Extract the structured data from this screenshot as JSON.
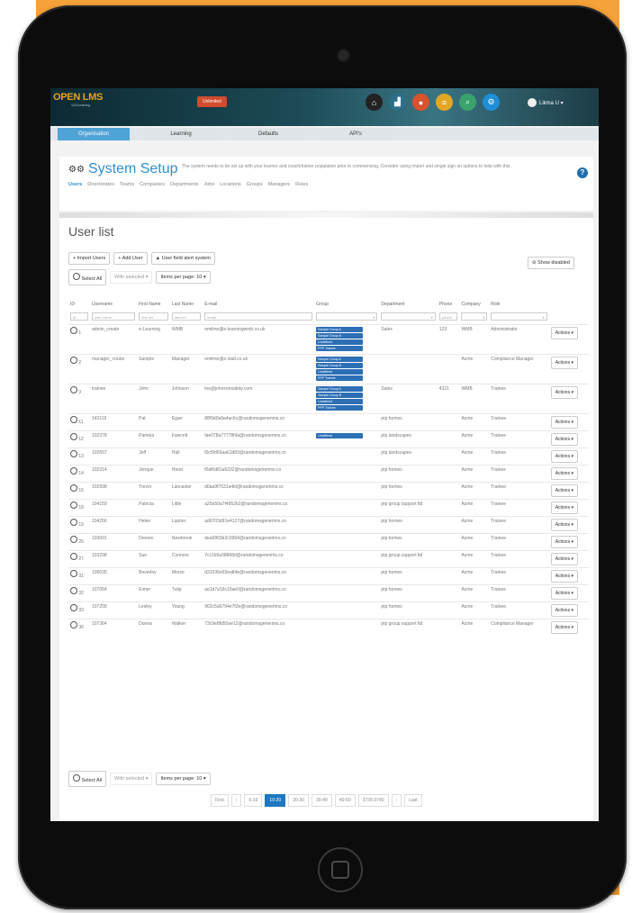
{
  "app": {
    "logo": "OPEN LMS",
    "logo_sub": "VLE/Learning",
    "badge": "Unlimited",
    "user_label": "Likma U ▾"
  },
  "nav_tabs": [
    "Organisation",
    "Learning",
    "Defaults",
    "API's"
  ],
  "header": {
    "title": "System Setup",
    "description": "The system needs to be set up with your learner and coach/trainer population prior to commencing. Consider using import and single sign on options to help with this.",
    "help": "?"
  },
  "subtabs": [
    "Users",
    "Directorates",
    "Teams",
    "Companies",
    "Departments",
    "Jobs",
    "Locations",
    "Groups",
    "Managers",
    "Roles"
  ],
  "page_title": "User list",
  "toolbar": {
    "import": "Import Users",
    "add": "Add User",
    "alert": "User field alert system",
    "show_disabled": "Show disabled"
  },
  "select_row": {
    "select_all": "Select All",
    "with_selected": "With selected ▾",
    "per_page": "Items per page: 10 ▾"
  },
  "columns": [
    "ID",
    "Username",
    "First Name",
    "Last Name",
    "E-mail",
    "Group",
    "Department",
    "Phone",
    "Company",
    "Role"
  ],
  "filters": {
    "id": "id",
    "username": "user name",
    "first": "first nm",
    "last": "last nm",
    "email": "email",
    "phone": "phone"
  },
  "rows": [
    {
      "id": "1",
      "username": "admin_create",
      "first": "e-Learning",
      "last": "WMB",
      "email": "emilme@e-learningwmb.co.uk",
      "groups": [
        "Sample Group A",
        "Sample Group B",
        "Undefined",
        "PPP Trainee"
      ],
      "dept": "Sales",
      "phone": "123",
      "company": "WMB",
      "role": "Administrator"
    },
    {
      "id": "2",
      "username": "manager_create",
      "first": "Sample",
      "last": "Manager",
      "email": "emilme@e-stall.co.uk",
      "groups": [
        "Sample Group A",
        "Sample Group B",
        "Undefined",
        "PPP Trainee"
      ],
      "dept": "",
      "phone": "",
      "company": "Acme",
      "role": "Compliance Manager"
    },
    {
      "id": "3",
      "username": "trainee",
      "first": "John",
      "last": "Johnson",
      "email": "lee@johnsonsafety.com",
      "groups": [
        "Sample Group A",
        "Sample Group B",
        "Undefined",
        "PPP Trainee"
      ],
      "dept": "Sales",
      "phone": "4321",
      "company": "WMB",
      "role": "Trainee"
    },
    {
      "id": "11",
      "username": "143119",
      "first": "Pat",
      "last": "Egan",
      "email": "88f3d0a9a4ac6c@randomsgenerims.co",
      "groups": [],
      "dept": "ptp homes",
      "phone": "",
      "company": "Acme",
      "role": "Trainee"
    },
    {
      "id": "12",
      "username": "102378",
      "first": "Pamela",
      "last": "Fawcett",
      "email": "fae078a77778f4a@randomsgenerims.co",
      "groups": [
        "Undefined"
      ],
      "dept": "ptp landscapes",
      "phone": "",
      "company": "Acme",
      "role": "Trainee"
    },
    {
      "id": "13",
      "username": "102657",
      "first": "Jeff",
      "last": "Hall",
      "email": "f0cf9d65aa61d83@randomsgenerims.co",
      "groups": [],
      "dept": "ptp landscapes",
      "phone": "",
      "company": "Acme",
      "role": "Trainee"
    },
    {
      "id": "14",
      "username": "102314",
      "first": "Jonque",
      "last": "Hood",
      "email": "f0af0d81a6332@randomsgenerims.co",
      "groups": [],
      "dept": "ptp homes",
      "phone": "",
      "company": "Acme",
      "role": "Trainee"
    },
    {
      "id": "16",
      "username": "102998",
      "first": "Trevor",
      "last": "Lancaster",
      "email": "d0aa9f7631a4ld@randomsgenerims.co",
      "groups": [],
      "dept": "ptp homes",
      "phone": "",
      "company": "Acme",
      "role": "Trainee"
    },
    {
      "id": "18",
      "username": "104159",
      "first": "Patricia",
      "last": "Little",
      "email": "a29a50a7f4952b2@randomsgenerims.co",
      "groups": [],
      "dept": "ptp group support ltd",
      "phone": "",
      "company": "Acme",
      "role": "Trainee"
    },
    {
      "id": "19",
      "username": "104256",
      "first": "Helen",
      "last": "Lupton",
      "email": "ad0703d91e4127@randomsgenerims.co",
      "groups": [],
      "dept": "ptp homes",
      "phone": "",
      "company": "Acme",
      "role": "Trainee"
    },
    {
      "id": "26",
      "username": "103091",
      "first": "Doreen",
      "last": "Newbrook",
      "email": "dea6803b2c0994@randomsgenerims.co",
      "groups": [],
      "dept": "ptp homes",
      "phone": "",
      "company": "Acme",
      "role": "Trainee"
    },
    {
      "id": "27",
      "username": "103298",
      "first": "Sue",
      "last": "Connors",
      "email": "7cc1b9a38868d@randomsgenerims.co",
      "groups": [],
      "dept": "ptp group support ltd",
      "phone": "",
      "company": "Acme",
      "role": "Trainee"
    },
    {
      "id": "31",
      "username": "106035",
      "first": "Beverley",
      "last": "Morse",
      "email": "d31036e65ea84e@randomsgenerims.co",
      "groups": [],
      "dept": "ptp homes",
      "phone": "",
      "company": "Acme",
      "role": "Trainee"
    },
    {
      "id": "32",
      "username": "107054",
      "first": "Eimer",
      "last": "Tulip",
      "email": "ae1d7e33c15ae0@randomsgenerims.co",
      "groups": [],
      "dept": "ptp homes",
      "phone": "",
      "company": "Acme",
      "role": "Trainee"
    },
    {
      "id": "33",
      "username": "107258",
      "first": "Lesley",
      "last": "Young",
      "email": "962c5a6794e7f3e@randomsgenerims.co",
      "groups": [],
      "dept": "ptp homes",
      "phone": "",
      "company": "Acme",
      "role": "Trainee"
    },
    {
      "id": "36",
      "username": "107364",
      "first": "Donna",
      "last": "Walker",
      "email": "73c9e8fd50ae12@randomsgenerims.co",
      "groups": [],
      "dept": "ptp group support ltd",
      "phone": "",
      "company": "Acme",
      "role": "Compliance Manager"
    }
  ],
  "row_action": "Actions ▾",
  "pager": [
    "First",
    "‹",
    "6-10",
    "10-20",
    "20-30",
    "30-40",
    "40-50",
    "3730-3740",
    "›",
    "Last"
  ],
  "pager_active": 3
}
